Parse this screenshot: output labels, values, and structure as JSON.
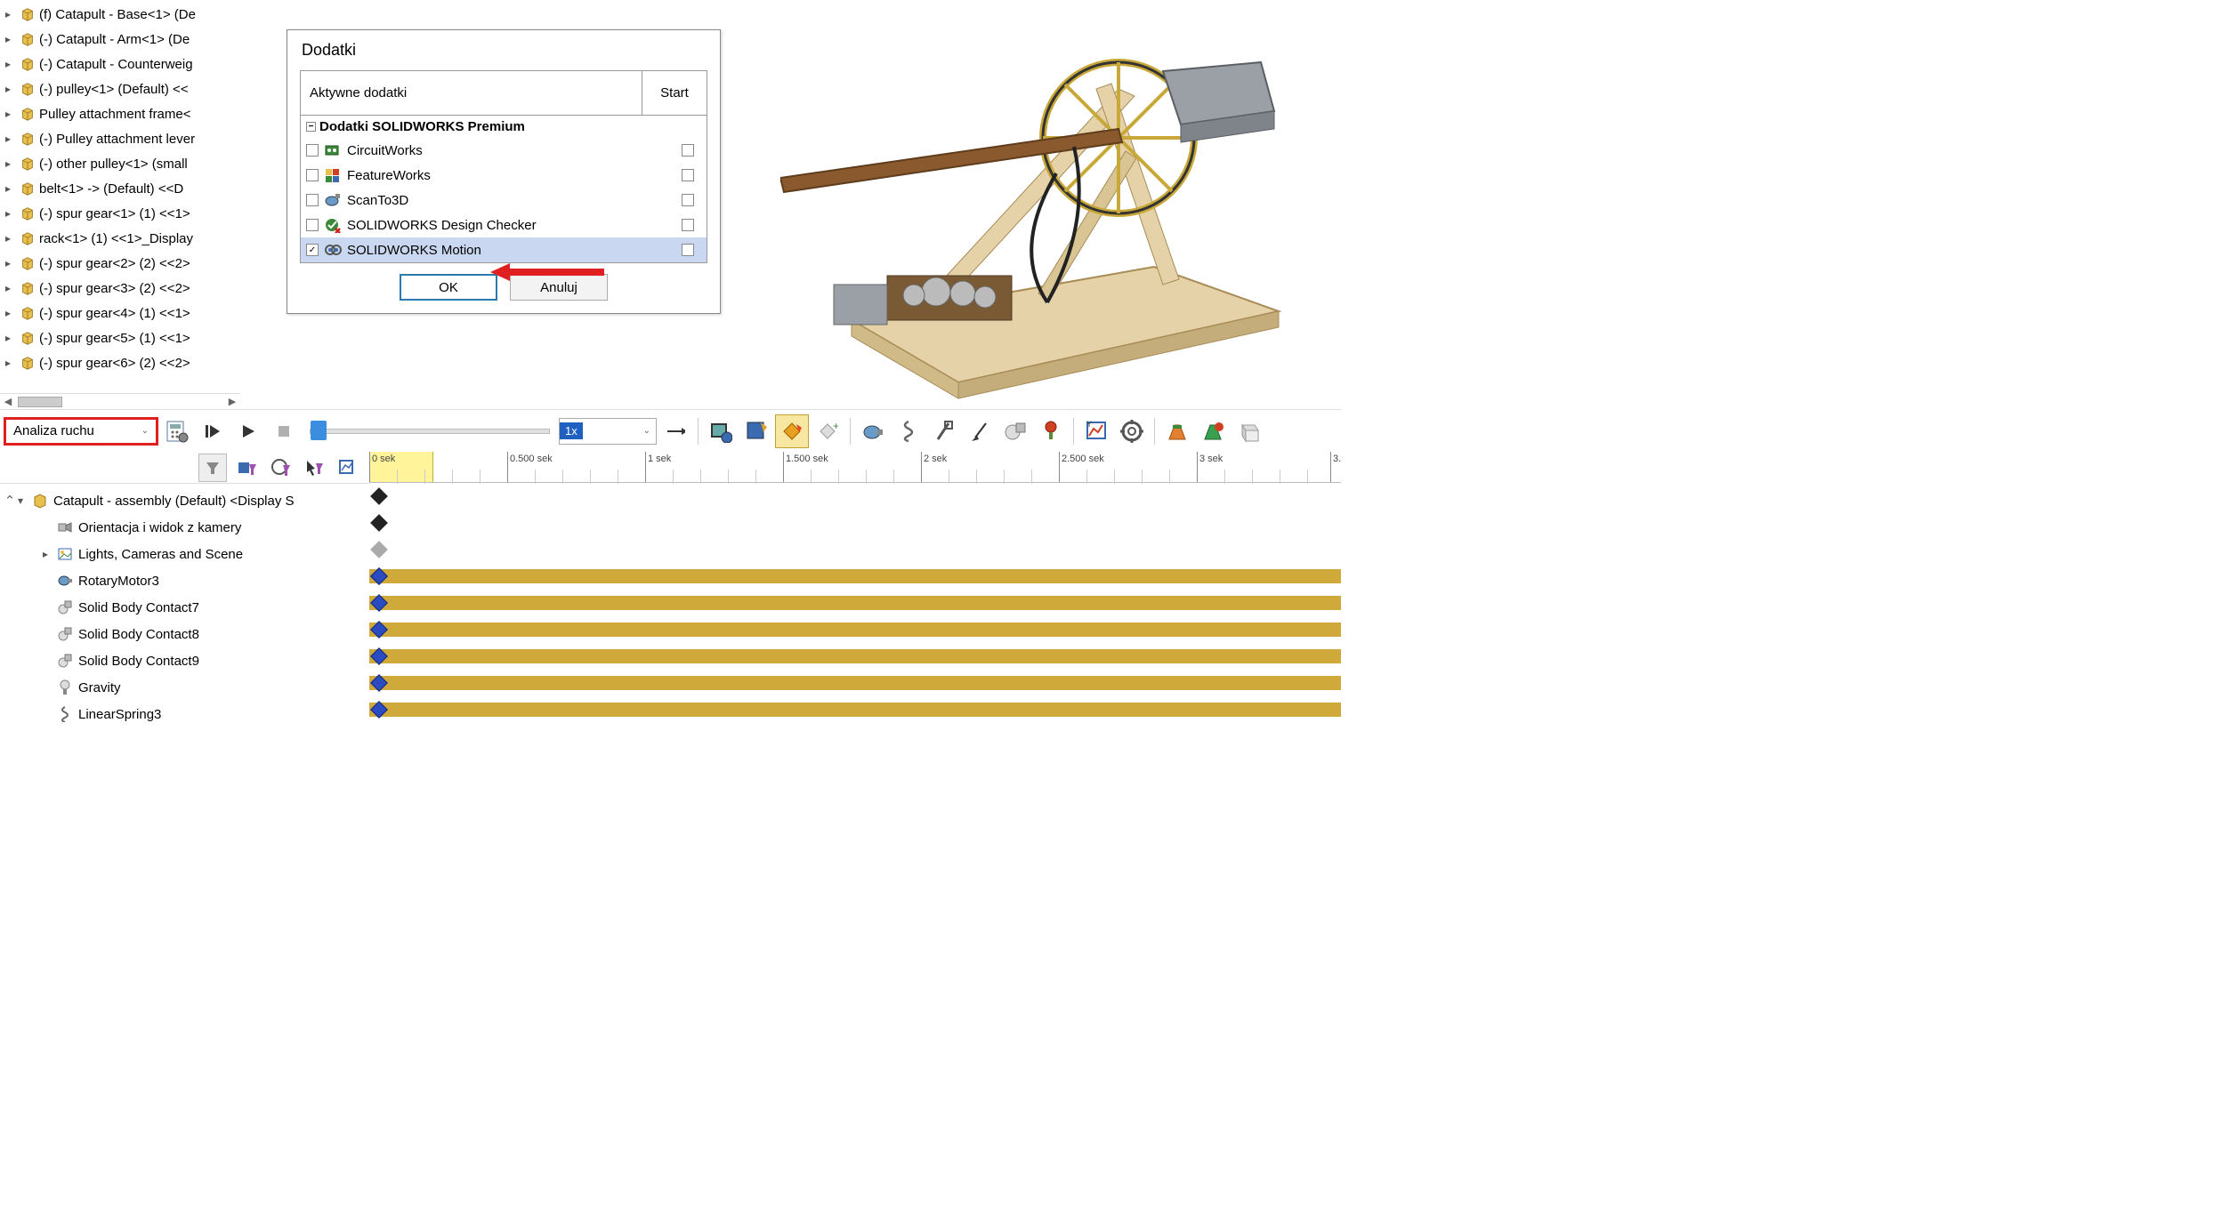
{
  "tree_items": [
    "(f) Catapult - Base<1> (De",
    "(-) Catapult - Arm<1> (De",
    "(-) Catapult - Counterweig",
    "(-) pulley<1> (Default) <<",
    "Pulley attachment frame<",
    "(-) Pulley attachment lever",
    "(-) other pulley<1> (small",
    "belt<1> -> (Default) <<D",
    "(-) spur gear<1> (1) <<1>",
    "rack<1> (1) <<1>_Display",
    "(-) spur gear<2> (2) <<2>",
    "(-) spur gear<3> (2) <<2>",
    "(-) spur gear<4> (1) <<1>",
    "(-) spur gear<5> (1) <<1>",
    "(-) spur gear<6> (2) <<2>"
  ],
  "dialog": {
    "title": "Dodatki",
    "col_active": "Aktywne dodatki",
    "col_start": "Start",
    "group": "Dodatki SOLIDWORKS Premium",
    "items": [
      {
        "label": "CircuitWorks",
        "checked": false
      },
      {
        "label": "FeatureWorks",
        "checked": false
      },
      {
        "label": "ScanTo3D",
        "checked": false
      },
      {
        "label": "SOLIDWORKS Design Checker",
        "checked": false
      },
      {
        "label": "SOLIDWORKS Motion",
        "checked": true,
        "selected": true
      }
    ],
    "ok": "OK",
    "cancel": "Anuluj"
  },
  "motion": {
    "study": "Analiza ruchu",
    "speed": "1x",
    "ruler_ticks": [
      {
        "pos": 0,
        "label": "0 sek"
      },
      {
        "pos": 155,
        "label": "0.500 sek"
      },
      {
        "pos": 310,
        "label": "1 sek"
      },
      {
        "pos": 465,
        "label": "1.500 sek"
      },
      {
        "pos": 620,
        "label": "2 sek"
      },
      {
        "pos": 775,
        "label": "2.500 sek"
      },
      {
        "pos": 930,
        "label": "3 sek"
      },
      {
        "pos": 1080,
        "label": "3."
      }
    ]
  },
  "timeline_tree": [
    {
      "label": "Catapult - assembly (Default) <Display S",
      "level": 0,
      "icon": "assembly",
      "caret": "▾",
      "key": "black"
    },
    {
      "label": "Orientacja i widok z kamery",
      "level": 1,
      "icon": "camera",
      "key": "black"
    },
    {
      "label": "Lights, Cameras and Scene",
      "level": 1,
      "icon": "scene",
      "caret": "▸",
      "key": "gray"
    },
    {
      "label": "RotaryMotor3",
      "level": 1,
      "icon": "motor",
      "bar": true,
      "key": "blue",
      "endkey": true
    },
    {
      "label": "Solid Body Contact7",
      "level": 1,
      "icon": "contact",
      "bar": true,
      "key": "blue"
    },
    {
      "label": "Solid Body Contact8",
      "level": 1,
      "icon": "contact",
      "bar": true,
      "key": "blue"
    },
    {
      "label": "Solid Body Contact9",
      "level": 1,
      "icon": "contact",
      "bar": true,
      "key": "blue"
    },
    {
      "label": "Gravity",
      "level": 1,
      "icon": "gravity",
      "bar": true,
      "key": "blue"
    },
    {
      "label": "LinearSpring3",
      "level": 1,
      "icon": "spring",
      "bar": true,
      "key": "blue"
    }
  ]
}
